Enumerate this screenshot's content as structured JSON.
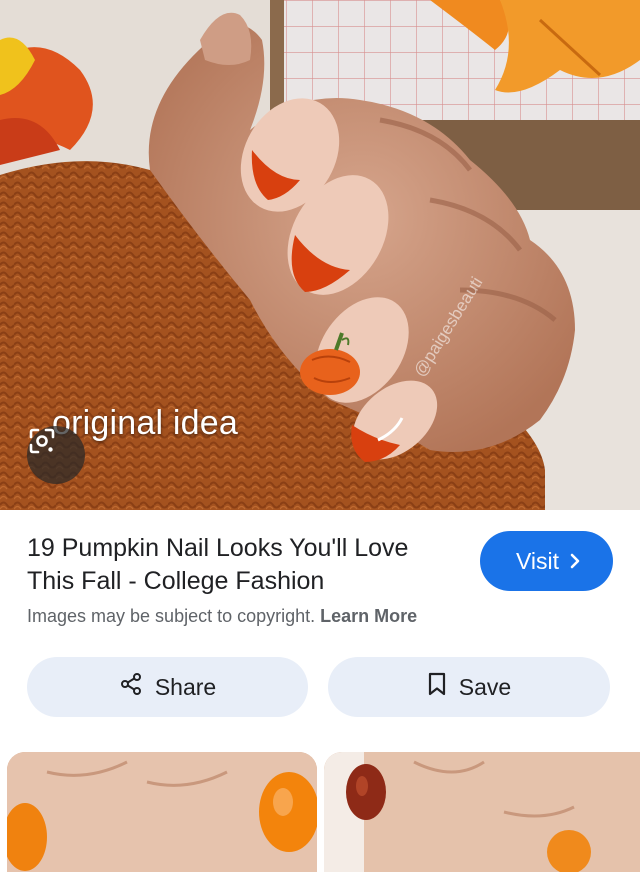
{
  "hero": {
    "overlay_text": "original idea",
    "watermark": "@paigesbeauti"
  },
  "result": {
    "title": "19 Pumpkin Nail Looks You'll Love This Fall - College Fashion",
    "copyright_text": "Images may be subject to copyright.",
    "learn_more": "Learn More",
    "visit_label": "Visit"
  },
  "actions": {
    "share_label": "Share",
    "save_label": "Save"
  },
  "colors": {
    "accent": "#1a73e8",
    "action_bg": "#e8eef8",
    "sweater": "#a9531f",
    "nail_orange": "#e0471c"
  },
  "icons": [
    "lens-icon",
    "chevron-right-icon",
    "share-icon",
    "bookmark-icon"
  ]
}
